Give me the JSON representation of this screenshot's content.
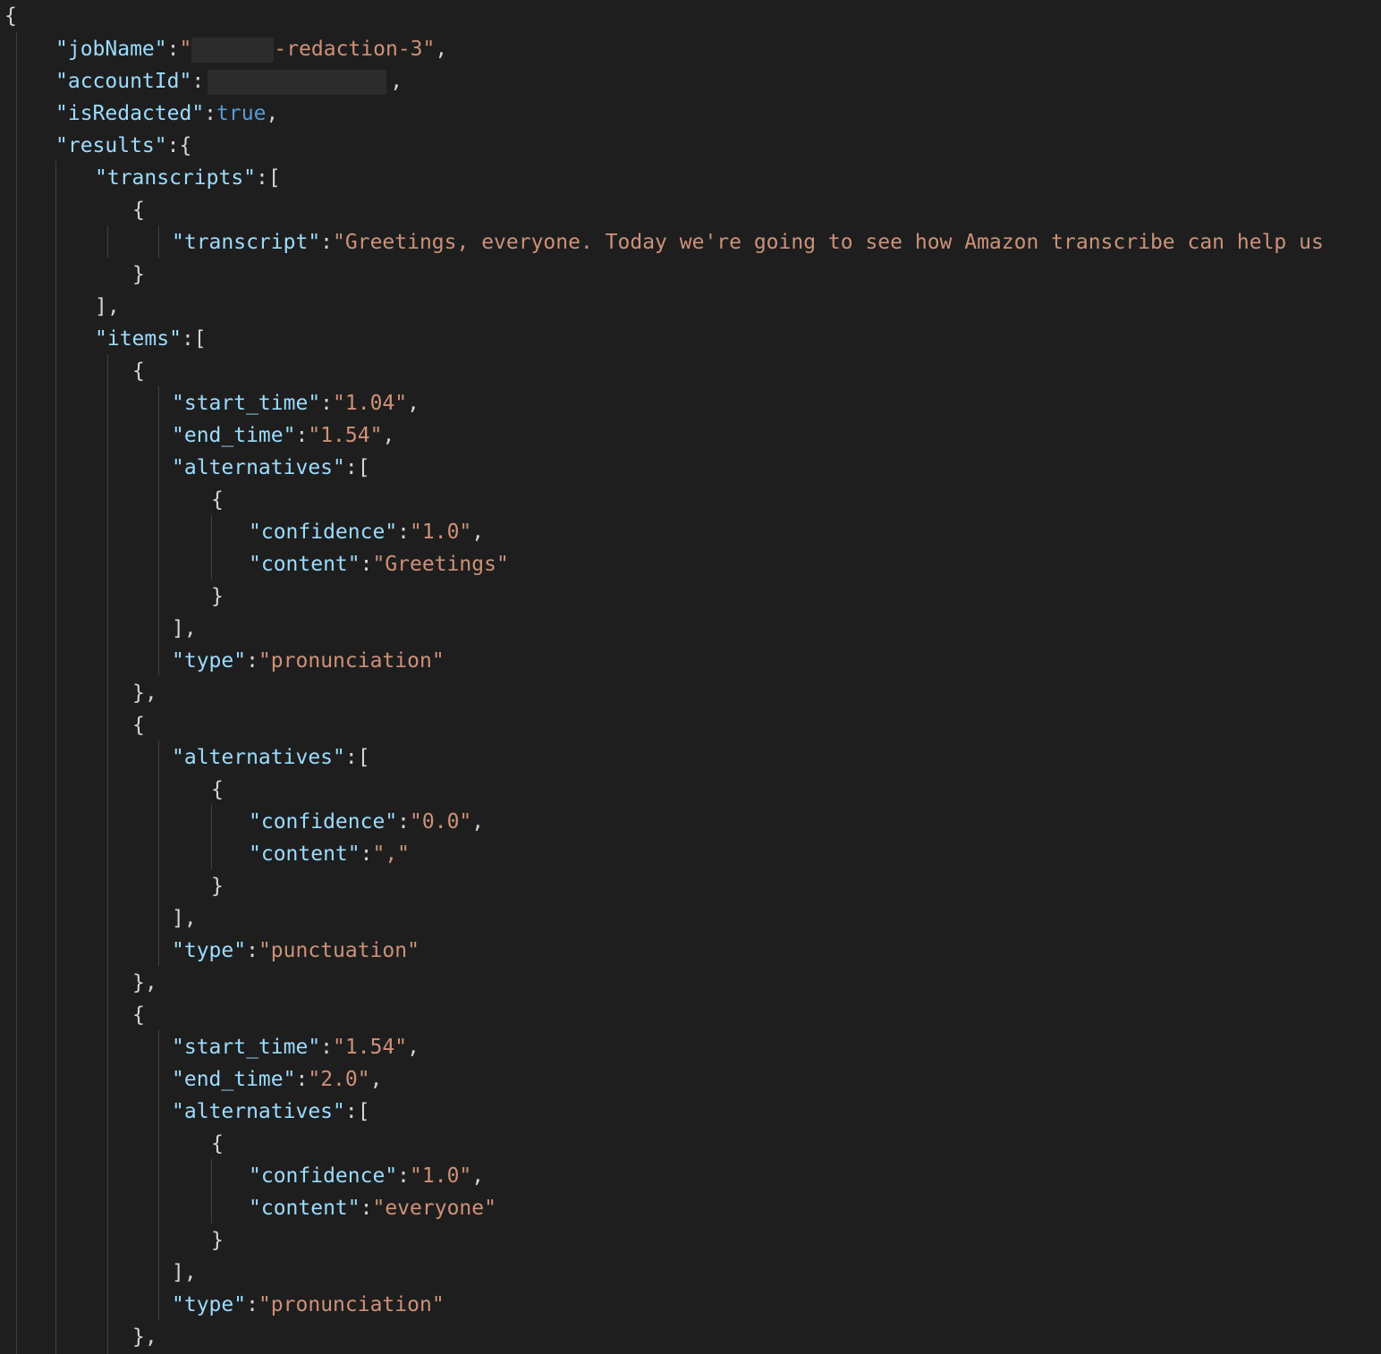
{
  "code": {
    "brace_open": "{",
    "brace_close": "}",
    "bracket_open": "[",
    "bracket_close": "]",
    "colon": ":",
    "comma": ",",
    "keys": {
      "jobName": "\"jobName\"",
      "accountId": "\"accountId\"",
      "isRedacted": "\"isRedacted\"",
      "results": "\"results\"",
      "transcripts": "\"transcripts\"",
      "transcript": "\"transcript\"",
      "items": "\"items\"",
      "start_time": "\"start_time\"",
      "end_time": "\"end_time\"",
      "alternatives": "\"alternatives\"",
      "confidence": "\"confidence\"",
      "content": "\"content\"",
      "type": "\"type\""
    },
    "jobName_prefix": "\"",
    "jobName_suffix": "-redaction-3\"",
    "isRedacted_value": "true",
    "transcript_value": "\"Greetings, everyone. Today we're going to see how Amazon transcribe can help us",
    "items": [
      {
        "start_time": "\"1.04\"",
        "end_time": "\"1.54\"",
        "confidence": "\"1.0\"",
        "content": "\"Greetings\"",
        "type": "\"pronunciation\""
      },
      {
        "confidence": "\"0.0\"",
        "content": "\",\"",
        "type": "\"punctuation\""
      },
      {
        "start_time": "\"1.54\"",
        "end_time": "\"2.0\"",
        "confidence": "\"1.0\"",
        "content": "\"everyone\"",
        "type": "\"pronunciation\""
      }
    ]
  }
}
